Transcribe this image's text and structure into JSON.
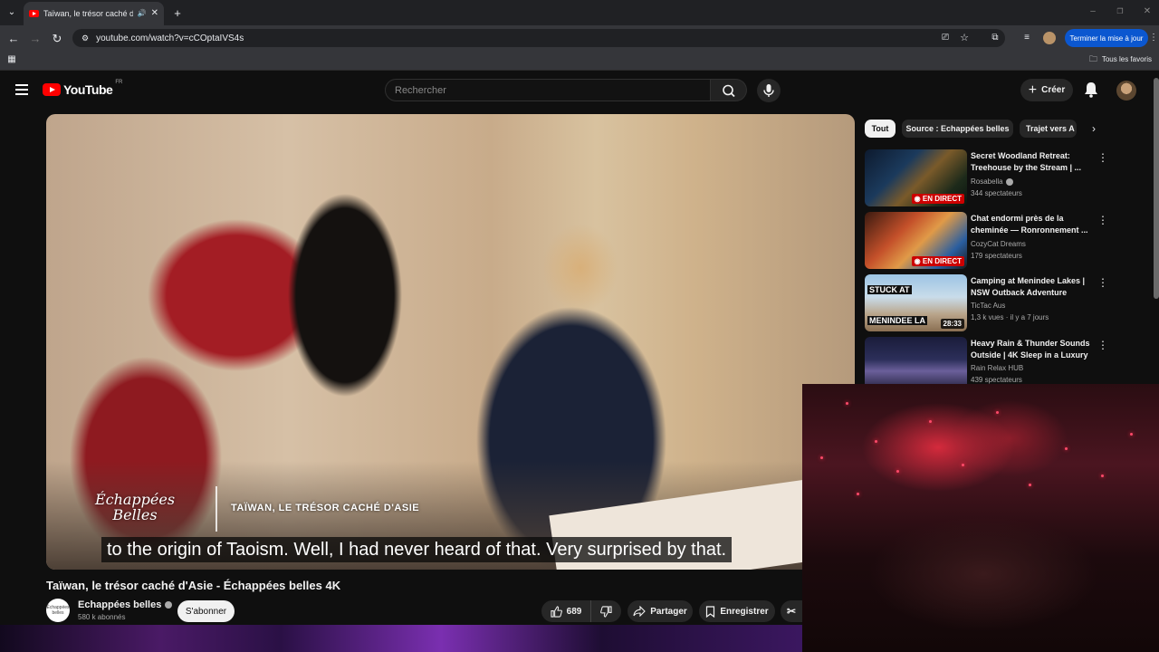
{
  "browser": {
    "tab_title": "Taïwan, le trésor caché d'Asie",
    "url": "youtube.com/watch?v=cCOptaIVS4s",
    "update_button": "Terminer la mise à jour",
    "bookmarks_folder": "Tous les favoris"
  },
  "youtube": {
    "logo_text": "YouTube",
    "country_code": "FR",
    "search_placeholder": "Rechercher",
    "create_label": "Créer"
  },
  "player": {
    "brand_line1": "Échappées",
    "brand_line2": "Belles",
    "brand_tagline": "TAÏWAN, LE TRÉSOR CACHÉ D'ASIE",
    "caption": "to the origin of Taoism. Well, I had never heard of that. Very surprised by that."
  },
  "video": {
    "title": "Taïwan, le trésor caché d'Asie - Échappées belles 4K",
    "channel_name": "Echappées belles",
    "channel_avatar_text": "Échappées belles",
    "subscribers": "580 k abonnés",
    "subscribe_label": "S'abonner",
    "likes": "689",
    "share_label": "Partager",
    "save_label": "Enregistrer"
  },
  "chips": [
    "Tout",
    "Source : Echappées belles",
    "Trajet vers A"
  ],
  "recommendations": [
    {
      "title": "Secret Woodland Retreat: Treehouse by the Stream | ...",
      "channel": "Rosabella",
      "verified": true,
      "meta": "344 spectateurs",
      "badge": "EN DIRECT",
      "badge_type": "live"
    },
    {
      "title": "Chat endormi près de la cheminée — Ronronnement ...",
      "channel": "CozyCat Dreams",
      "verified": false,
      "meta": "179 spectateurs",
      "badge": "EN DIRECT",
      "badge_type": "live"
    },
    {
      "title": "Camping at Menindee Lakes | NSW Outback Adventure",
      "channel": "TicTac Aus",
      "verified": false,
      "meta": "1,3 k vues · il y a 7 jours",
      "badge": "28:33",
      "badge_type": "duration",
      "thumb_text_1": "STUCK AT",
      "thumb_text_2": "MENINDEE LA"
    },
    {
      "title": "Heavy Rain & Thunder Sounds Outside | 4K Sleep in a Luxury ...",
      "channel": "Rain Relax HUB",
      "verified": false,
      "meta": "439 spectateurs",
      "badge": "",
      "badge_type": "live"
    }
  ],
  "colors": {
    "background": "#0f0f0f",
    "accent_red": "#ff0000",
    "live_red": "#cc0000",
    "chip_active": "#f1f1f1",
    "update_blue": "#0b57d0"
  }
}
